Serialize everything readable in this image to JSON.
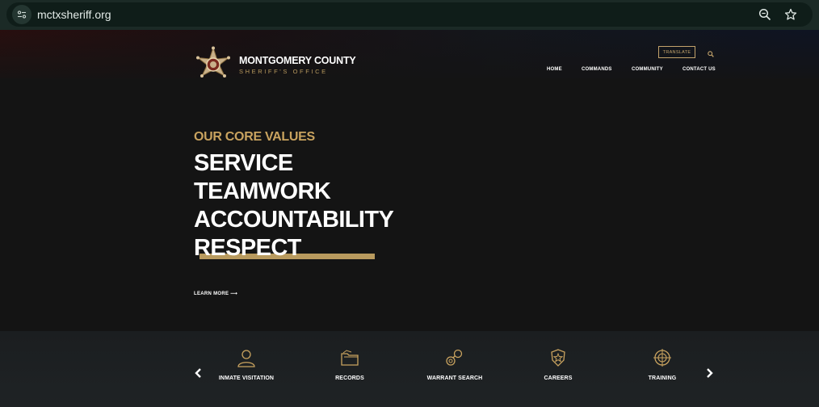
{
  "browser": {
    "url": "mctxsheriff.org"
  },
  "header": {
    "brand_title": "MONTGOMERY COUNTY",
    "brand_subtitle": "SHERIFF'S OFFICE",
    "translate_label": "TRANSLATE",
    "nav": [
      {
        "label": "HOME"
      },
      {
        "label": "COMMANDS"
      },
      {
        "label": "COMMUNITY"
      },
      {
        "label": "CONTACT US"
      }
    ]
  },
  "hero": {
    "eyebrow": "OUR CORE VALUES",
    "values": [
      "SERVICE",
      "TEAMWORK",
      "ACCOUNTABILITY",
      "RESPECT"
    ],
    "cta": "LEARN MORE ⟶"
  },
  "quick_links": [
    {
      "label": "INMATE VISITATION",
      "icon": "person-icon"
    },
    {
      "label": "RECORDS",
      "icon": "folder-icon"
    },
    {
      "label": "WARRANT SEARCH",
      "icon": "handcuffs-icon"
    },
    {
      "label": "CAREERS",
      "icon": "badge-icon"
    },
    {
      "label": "TRAINING",
      "icon": "target-icon"
    }
  ],
  "colors": {
    "accent_gold": "#c9a35f",
    "background": "#141414",
    "browser_bar": "#1b2a26"
  }
}
